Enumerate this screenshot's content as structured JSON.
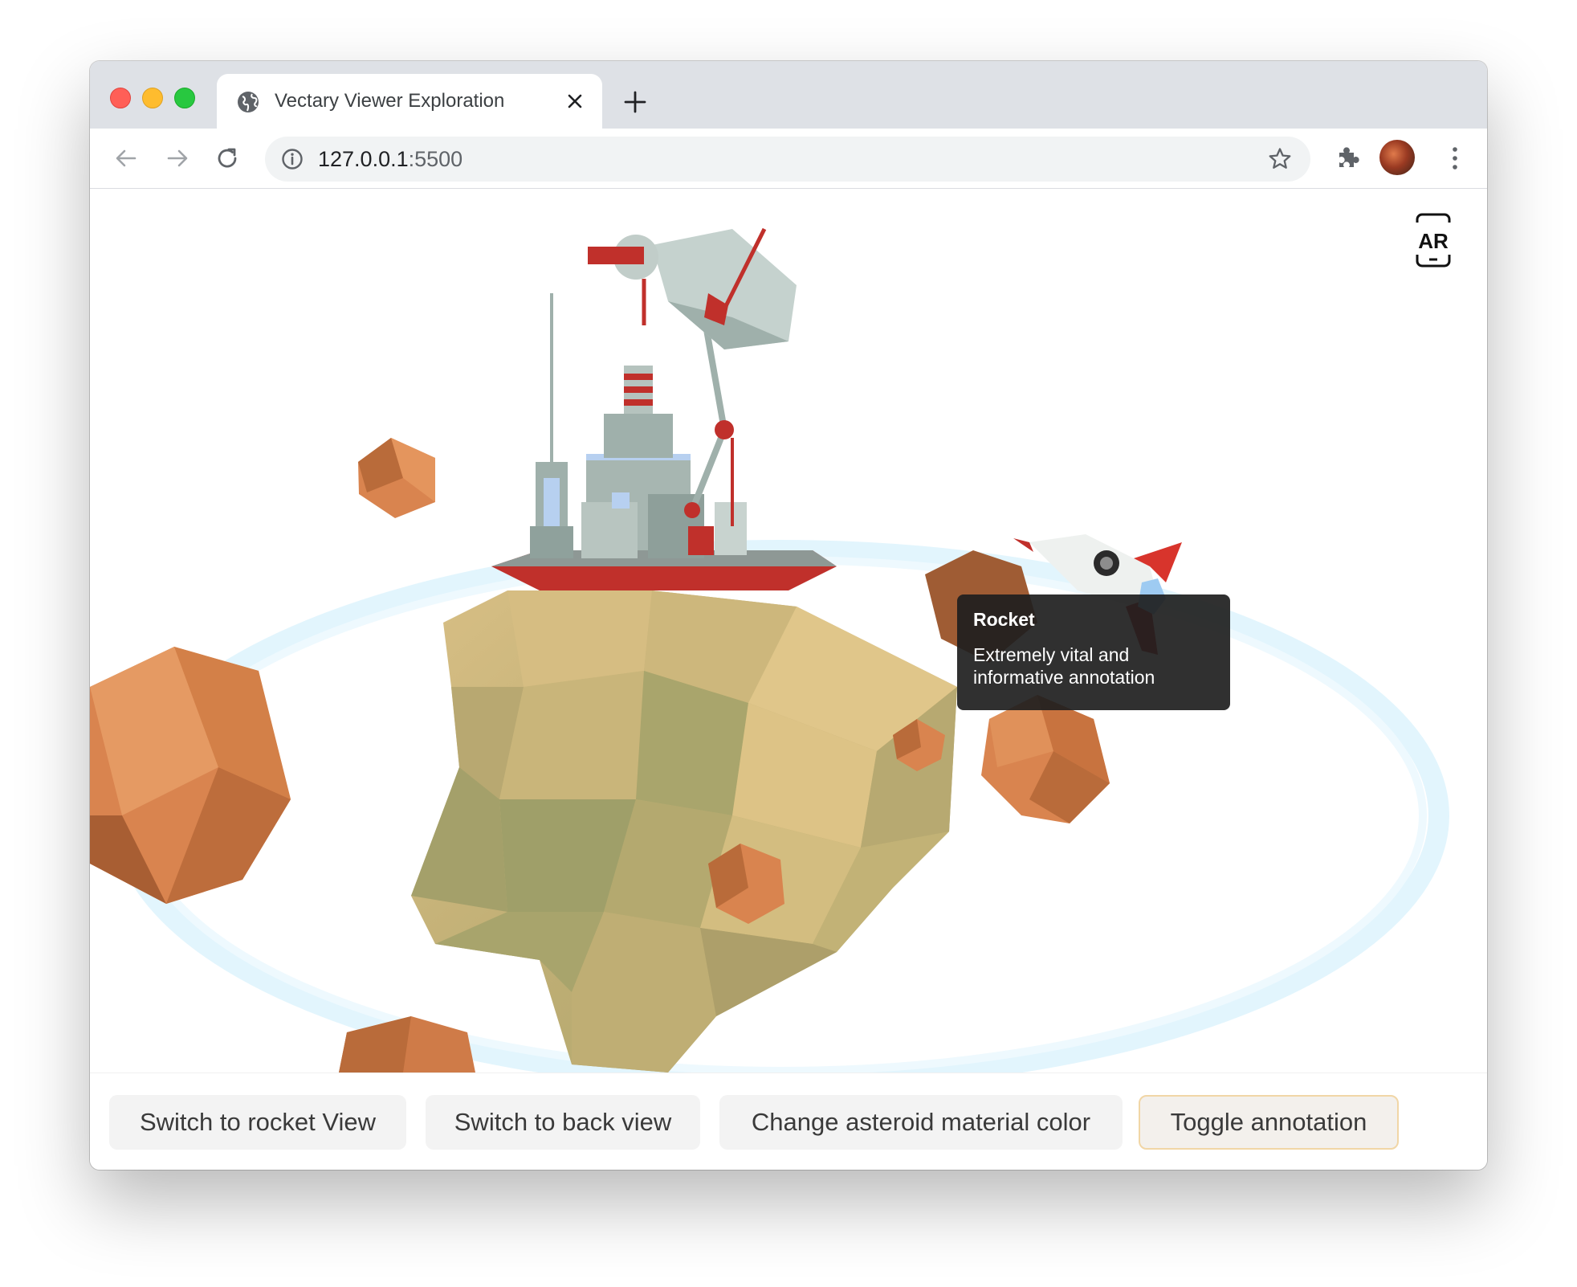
{
  "browser": {
    "tab_title": "Vectary Viewer Exploration",
    "url_host": "127.0.0.1",
    "url_port": ":5500"
  },
  "viewer": {
    "ar_label": "AR",
    "annotation": {
      "title": "Rocket",
      "body": "Extremely vital and informative annotation"
    },
    "colors": {
      "asteroid": "#d9844f",
      "planet": "#c9b47a",
      "station": "#9fb0ab",
      "accent_red": "#c0302b",
      "orbit_ring": "#cfeefc"
    }
  },
  "controls": {
    "rocket_view": "Switch to rocket View",
    "back_view": "Switch to back view",
    "asteroid_color": "Change asteroid material color",
    "toggle_annotation": "Toggle annotation"
  }
}
